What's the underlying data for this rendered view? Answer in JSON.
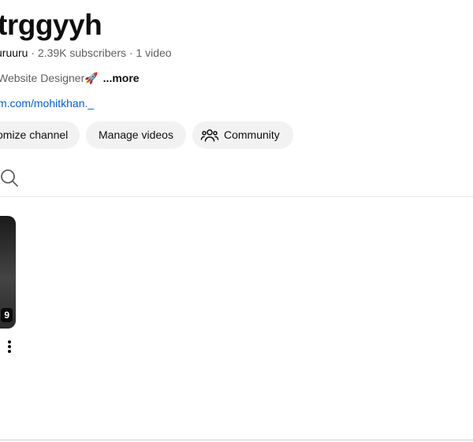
{
  "channel": {
    "title": "trggyyh",
    "handle": "uruuru",
    "subscribers": "2.39K subscribers",
    "video_count": "1 video",
    "separator": " · ",
    "description": "Website Designer🚀",
    "more_label": "...more",
    "link": "m.com/mohitkhan._"
  },
  "buttons": {
    "customize_label": "omize channel",
    "manage_label": "Manage videos",
    "community_label": "Community"
  },
  "video": {
    "duration": "9"
  },
  "icons": {
    "search": "search-icon",
    "community": "people-icon",
    "more": "kebab-menu-icon"
  },
  "colors": {
    "link": "#065fd4",
    "button_bg": "#f2f2f2",
    "text_secondary": "#606060"
  }
}
